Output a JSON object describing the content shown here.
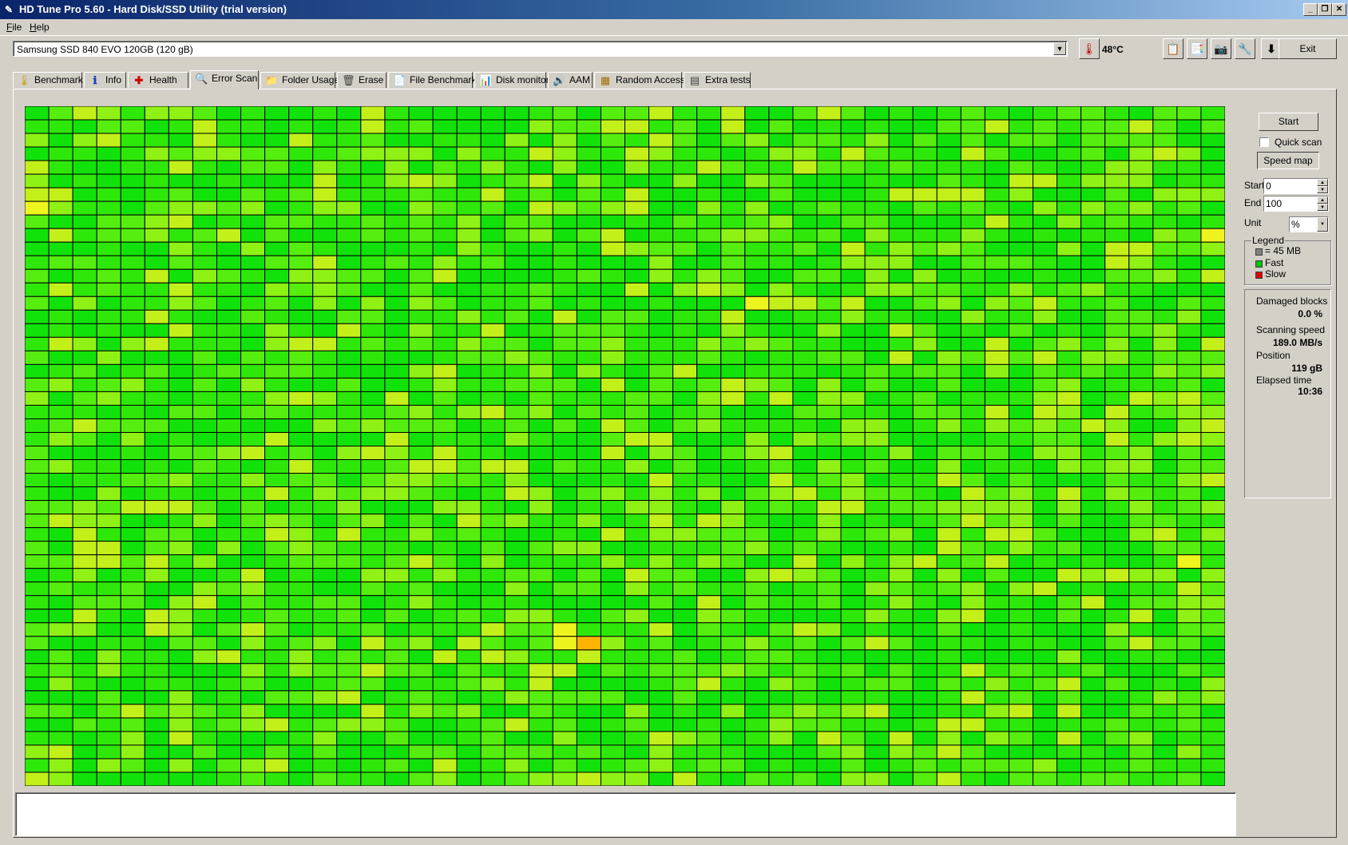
{
  "window": {
    "title": "HD Tune Pro 5.60 - Hard Disk/SSD Utility (trial version)",
    "controls": [
      "_",
      "❐",
      "✕"
    ]
  },
  "menu": [
    {
      "label": "File",
      "accel": "F",
      "rest": "ile"
    },
    {
      "label": "Help",
      "accel": "H",
      "rest": "elp"
    }
  ],
  "toolbar": {
    "drive": "Samsung SSD 840 EVO 120GB (120 gB)",
    "temperature": "48°C",
    "exit_label": "Exit",
    "icons": [
      "thermometer-icon",
      "copy-text-icon",
      "copy-info-icon",
      "screenshot-icon",
      "options-icon",
      "save-icon"
    ]
  },
  "tabs": [
    {
      "label": "Benchmark",
      "icon": "benchmark-icon",
      "glyph": "🌡"
    },
    {
      "label": "Info",
      "icon": "info-icon",
      "glyph": "ℹ"
    },
    {
      "label": "Health",
      "icon": "health-icon",
      "glyph": "✚"
    },
    {
      "label": "Error Scan",
      "icon": "error-scan-icon",
      "glyph": "🔍",
      "active": true
    },
    {
      "label": "Folder Usage",
      "icon": "folder-icon",
      "glyph": "📁"
    },
    {
      "label": "Erase",
      "icon": "erase-icon",
      "glyph": "🗑"
    },
    {
      "label": "File Benchmark",
      "icon": "file-benchmark-icon",
      "glyph": "📄"
    },
    {
      "label": "Disk monitor",
      "icon": "disk-monitor-icon",
      "glyph": "📊"
    },
    {
      "label": "AAM",
      "icon": "aam-icon",
      "glyph": "🔊"
    },
    {
      "label": "Random Access",
      "icon": "random-access-icon",
      "glyph": "▦"
    },
    {
      "label": "Extra tests",
      "icon": "extra-tests-icon",
      "glyph": "▤"
    }
  ],
  "scan": {
    "start_label": "Start",
    "quick_scan_label": "Quick scan",
    "quick_scan_checked": false,
    "speed_map_label": "Speed map",
    "range": {
      "start_label": "Start",
      "start_value": "0",
      "end_label": "End",
      "end_value": "100",
      "unit_label": "Unit",
      "unit_value": "%"
    },
    "legend": {
      "title": "Legend",
      "items": [
        {
          "label": "= 45 MB",
          "color": "#808080"
        },
        {
          "label": "Fast",
          "color": "#00c000"
        },
        {
          "label": "Slow",
          "color": "#e00000"
        }
      ]
    },
    "stats": {
      "damaged_label": "Damaged blocks",
      "damaged_value": "0.0 %",
      "speed_label": "Scanning speed",
      "speed_value": "189.0 MB/s",
      "position_label": "Position",
      "position_value": "119 gB",
      "elapsed_label": "Elapsed time",
      "elapsed_value": "10:36"
    }
  },
  "block_map": {
    "columns": 50,
    "rows": 50,
    "palette": {
      "fast": "#11e30a",
      "fast_alt": "#2ee80a",
      "mid": "#55ee0e",
      "medium": "#8ff214",
      "slower": "#c4f01a",
      "slowest_seen": "#eef41e",
      "orange": "#ffb400",
      "border": "#000000"
    },
    "notable_cells": [
      {
        "row": 7,
        "col": 0,
        "shade": "slowest_seen"
      },
      {
        "row": 9,
        "col": 49,
        "shade": "slowest_seen"
      },
      {
        "row": 14,
        "col": 30,
        "shade": "slowest_seen"
      },
      {
        "row": 33,
        "col": 48,
        "shade": "slowest_seen"
      },
      {
        "row": 38,
        "col": 22,
        "shade": "slowest_seen"
      },
      {
        "row": 39,
        "col": 22,
        "shade": "slowest_seen"
      },
      {
        "row": 39,
        "col": 23,
        "shade": "orange"
      }
    ]
  }
}
